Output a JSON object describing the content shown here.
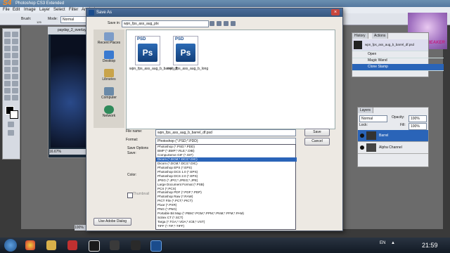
{
  "app": {
    "logo": "S4",
    "title": "Photoshop CS3 Extended",
    "menu": [
      "File",
      "Edit",
      "Image",
      "Layer",
      "Select",
      "Filter",
      "Analysis"
    ],
    "options": {
      "brush_label": "Brush:",
      "brush_size": "125",
      "mode_label": "Mode:",
      "mode_value": "Normal"
    },
    "doc_title": "payday_2_overlay",
    "zoom": "16.67%",
    "bottom_zoom": "100%",
    "logo_text": "ANIME BREAKER"
  },
  "dialog": {
    "title": "Save As",
    "save_in_label": "Save in:",
    "save_in_value": "wpn_fps_ass_aug_ptx",
    "places": [
      "Recent Places",
      "Desktop",
      "Libraries",
      "Computer",
      "Network"
    ],
    "files": [
      {
        "name": "wpn_fps_ass_aug_b_barrel_df",
        "tag": "PSD",
        "glyph": "Ps"
      },
      {
        "name": "wpn_fps_ass_aug_b_long",
        "tag": "PSD",
        "glyph": "Ps"
      }
    ],
    "file_name_label": "File name:",
    "file_name_value": "wpn_fps_ass_aug_b_barrel_df.psd",
    "format_label": "Format:",
    "format_value": "Photoshop (*.PSD;*.PDD)",
    "save_button": "Save",
    "cancel_button": "Cancel",
    "save_options_label": "Save Options",
    "save_label": "Save:",
    "color_label": "Color:",
    "thumbnail_label": "Thumbnail",
    "use_adobe_dialog": "Use Adobe Dialog",
    "format_options": [
      "Photoshop (*.PSD;*.PDD)",
      "BMP (*.BMP;*.RLE;*.DIB)",
      "CompuServe GIF (*.GIF)",
      "Dicom (*.DCM;*.DC3;*.DIC)",
      "Dicom (*.DCM;*.DC3;*.DIC)",
      "Photoshop EPS (*.EPS)",
      "Photoshop DCS 1.0 (*.EPS)",
      "Photoshop DCS 2.0 (*.EPS)",
      "JPEG (*.JPG;*.JPEG;*.JPE)",
      "Large Document Format (*.PSB)",
      "PCX (*.PCX)",
      "Photoshop PDF (*.PDF;*.PDP)",
      "Photoshop Raw (*.RAW)",
      "PICT File (*.PCT;*.PICT)",
      "Pixar (*.PXR)",
      "PNG (*.PNG)",
      "Portable Bit Map (*.PBM;*.PGM;*.PPM;*.PNM;*.PFM;*.PAM)",
      "Scitex CT (*.SCT)",
      "Targa (*.TGA;*.VDA;*.ICB;*.VST)",
      "TIFF (*.TIF;*.TIFF)"
    ],
    "selected_format_index": 3
  },
  "history": {
    "tabs": [
      "History",
      "Actions"
    ],
    "items": [
      "wpn_fps_ass_aug_b_barrel_df.psd",
      "Open",
      "Magic Wand",
      "Clone Stamp"
    ],
    "active_item": "Clone Stamp"
  },
  "layers": {
    "tabs": [
      "Layers"
    ],
    "blend": "Normal",
    "opacity_label": "Opacity:",
    "opacity_value": "100%",
    "fill_label": "Fill:",
    "fill_value": "100%",
    "lock_label": "Lock:",
    "items": [
      "Barrel",
      "Alpha Channel"
    ],
    "active": "Barrel"
  },
  "taskbar": {
    "clock": "21:59",
    "lang": "EN",
    "tray_arrow": "▲"
  },
  "colors": {
    "selection": "#2a64b8",
    "dialog_title": "#4a6d9a",
    "close": "#c9463d"
  }
}
